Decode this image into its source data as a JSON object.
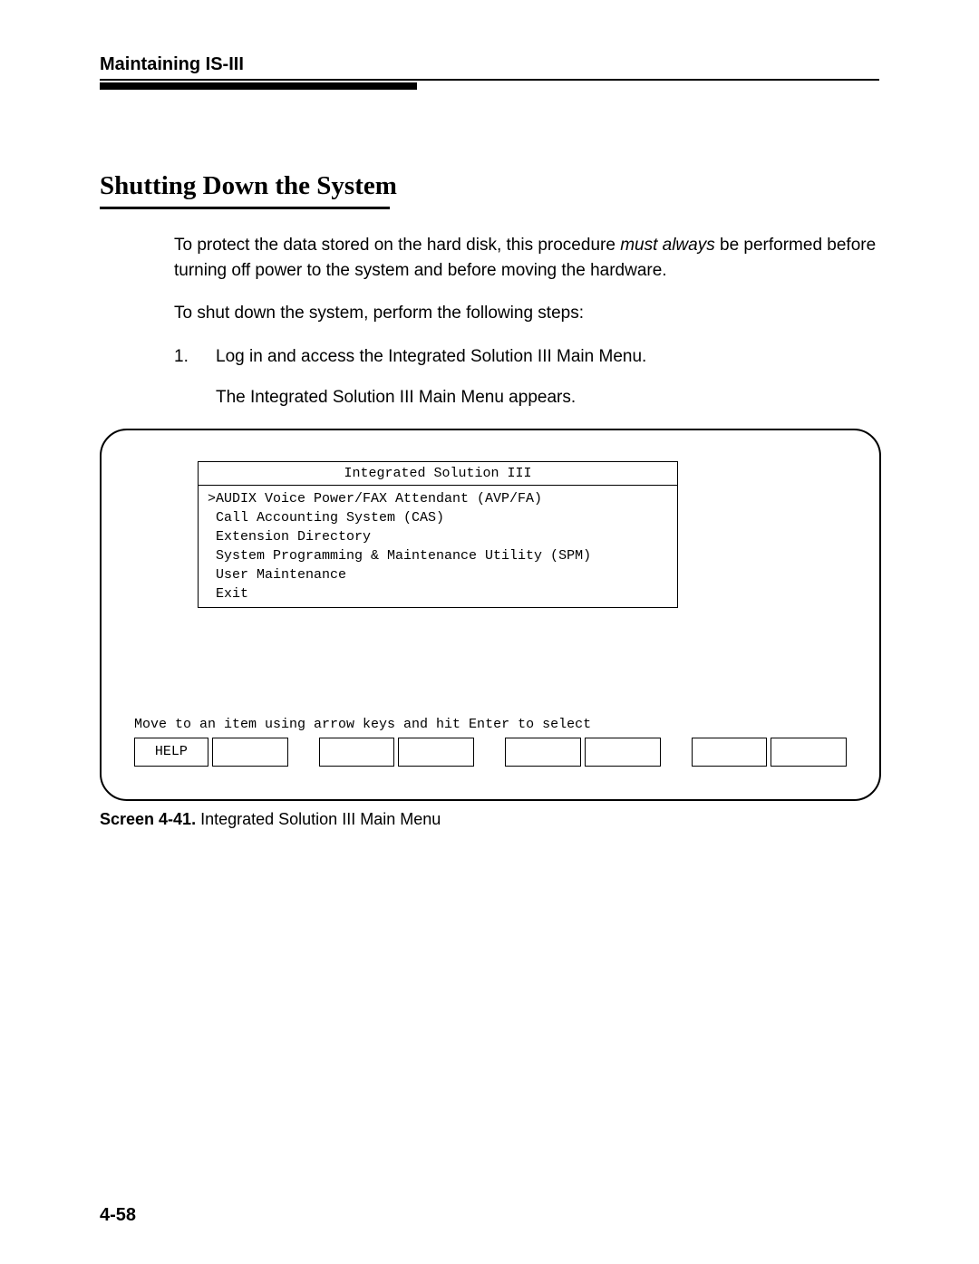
{
  "header": {
    "title": "Maintaining IS-III"
  },
  "section": {
    "title": "Shutting Down the System"
  },
  "body": {
    "p1a": "To protect the data stored on the hard disk, this procedure ",
    "p1em": "must always",
    "p1b": " be performed before turning off power to the system and before moving the hardware.",
    "p2": "To shut down the system, perform the following steps:",
    "step_num": "1.",
    "step_text": "Log in and access the Integrated Solution III Main Menu.",
    "step_sub": "The Integrated Solution III Main Menu appears."
  },
  "terminal": {
    "window_title": "Integrated Solution III",
    "menu": {
      "line1": ">AUDIX Voice Power/FAX Attendant (AVP/FA)",
      "line2": " Call Accounting System (CAS)",
      "line3": " Extension Directory",
      "line4": " System Programming & Maintenance Utility (SPM)",
      "line5": " User Maintenance",
      "line6": " Exit"
    },
    "status": "Move to an item using arrow keys and hit Enter to select",
    "fkeys": {
      "f1": "HELP",
      "f2": "",
      "f3": "",
      "f4": "",
      "f5": "",
      "f6": "",
      "f7": "",
      "f8": ""
    }
  },
  "caption": {
    "bold": "Screen 4-41.",
    "rest": " Integrated Solution III Main Menu"
  },
  "page_num": "4-58"
}
